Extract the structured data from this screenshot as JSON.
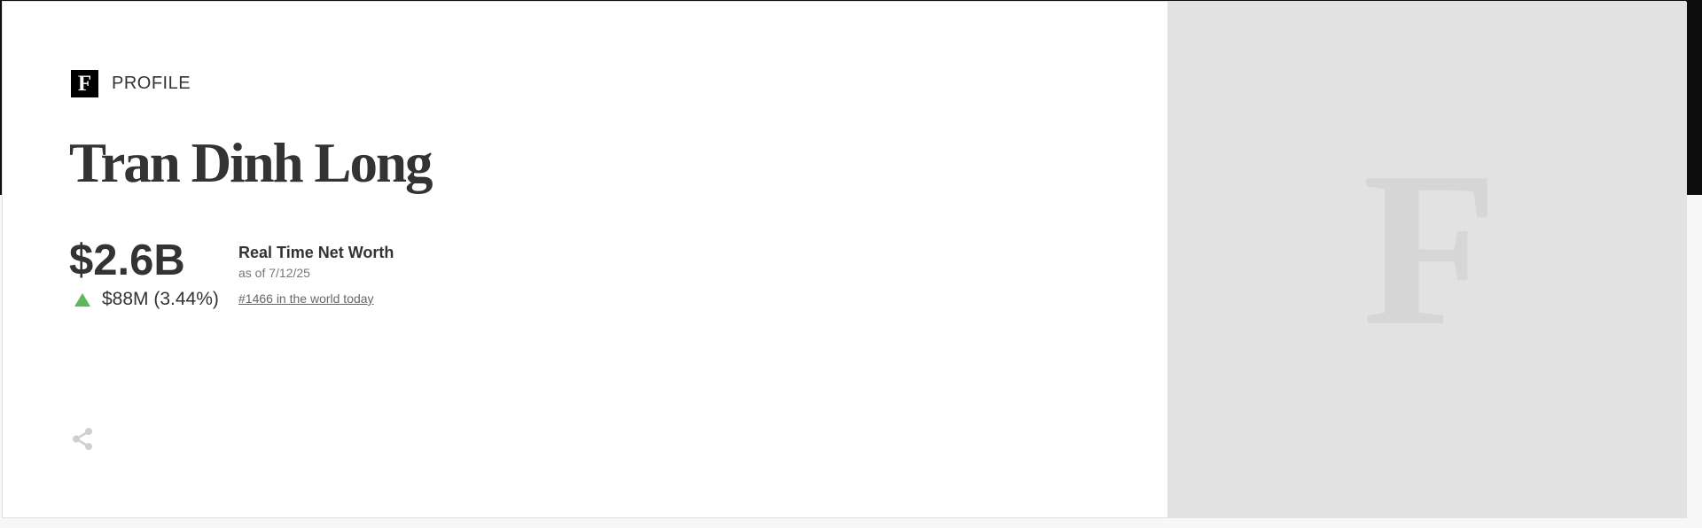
{
  "brand": {
    "logo_letter": "F",
    "section_label": "PROFILE",
    "watermark_letter": "F"
  },
  "profile": {
    "name": "Tran Dinh Long",
    "net_worth": "$2.6B",
    "change": "$88M (3.44%)",
    "change_direction": "up",
    "net_worth_label": "Real Time Net Worth",
    "as_of": "as of 7/12/25",
    "rank_link": "#1466 in the world today"
  },
  "icons": {
    "share": "share-icon",
    "trend": "up-triangle-icon"
  },
  "colors": {
    "accent_up": "#5cb85c",
    "text": "#333333",
    "image_placeholder_bg": "#e2e2e2",
    "top_bar": "#0d0d0d"
  }
}
